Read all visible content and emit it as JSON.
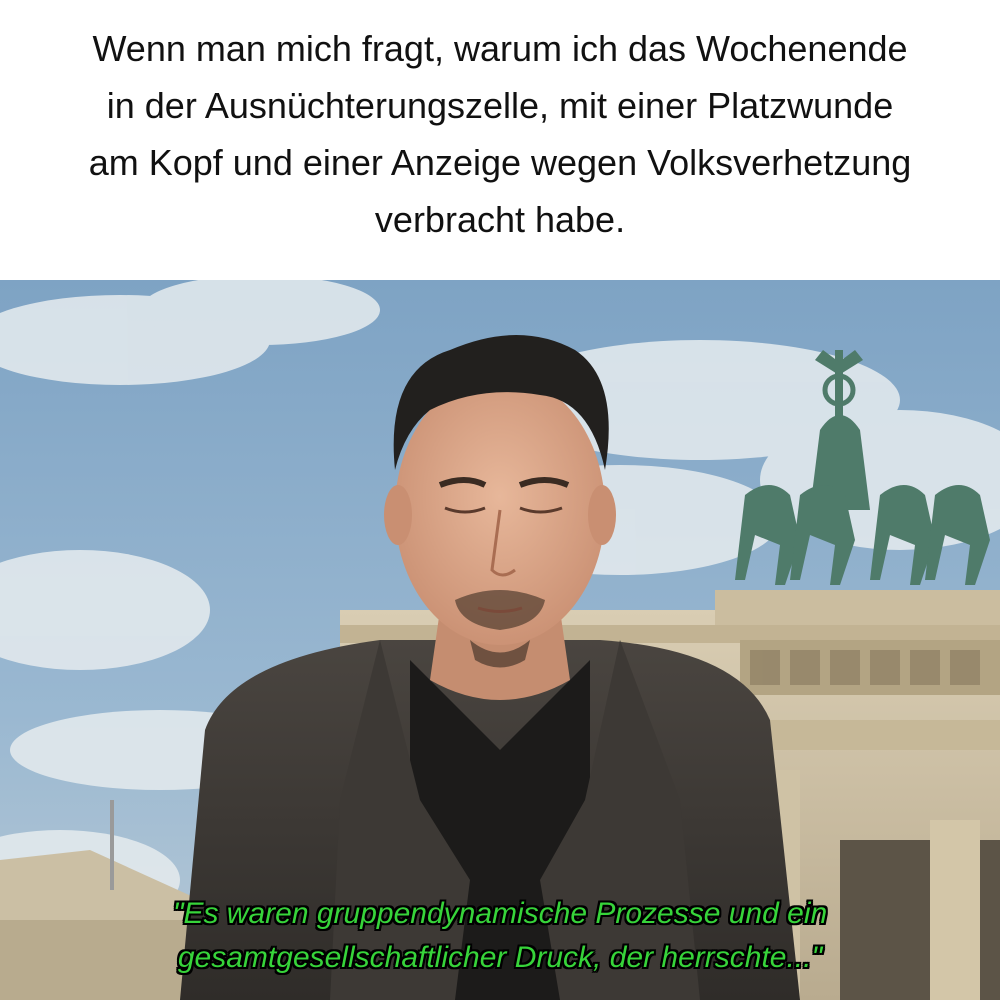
{
  "caption": {
    "lines": [
      "Wenn man mich fragt, warum ich das Wochenende",
      "in der Ausnüchterungszelle, mit einer Platzwunde",
      "am Kopf und einer Anzeige wegen Volksverhetzung",
      "verbracht habe."
    ]
  },
  "subtitle": {
    "lines": [
      "\"Es waren gruppendynamische Prozesse und ein",
      "gesamtgesellschaftlicher Druck, der herrschte...\""
    ],
    "color": "#37d43a"
  }
}
